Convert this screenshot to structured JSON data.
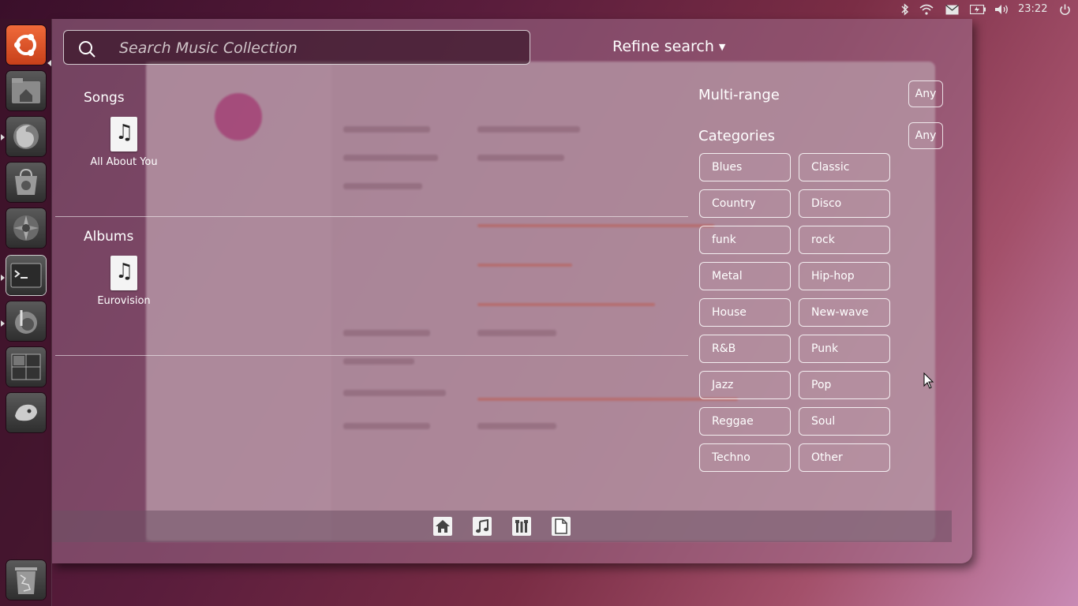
{
  "top_panel": {
    "clock": "23:22",
    "indicators": [
      "bluetooth-icon",
      "wifi-icon",
      "mail-icon",
      "battery-icon",
      "volume-icon",
      "power-icon"
    ]
  },
  "launcher": {
    "items": [
      "ubuntu-logo-icon",
      "home-folder-icon",
      "firefox-icon",
      "software-center-icon",
      "shotwell-icon",
      "terminal-icon",
      "banshee-icon",
      "workspaces-icon",
      "gwibber-icon",
      "trash-icon"
    ]
  },
  "search": {
    "placeholder": "Search Music Collection",
    "value": ""
  },
  "refine": {
    "label": "Refine search",
    "arrow": "▼"
  },
  "results": {
    "songs": {
      "title": "Songs",
      "items": [
        {
          "label": "All About You",
          "icon": "music-file-icon"
        }
      ]
    },
    "albums": {
      "title": "Albums",
      "items": [
        {
          "label": "Eurovision",
          "icon": "music-file-icon"
        }
      ]
    }
  },
  "filters": {
    "multirange": {
      "label": "Multi-range",
      "any": "Any"
    },
    "categories": {
      "label": "Categories",
      "any": "Any",
      "items": [
        "Blues",
        "Classic",
        "Country",
        "Disco",
        "funk",
        "rock",
        "Metal",
        "Hip-hop",
        "House",
        "New-wave",
        "R&B",
        "Punk",
        "Jazz",
        "Pop",
        "Reggae",
        "Soul",
        "Techno",
        "Other"
      ]
    }
  },
  "lens_bar": [
    "home-lens-icon",
    "music-lens-icon",
    "applications-lens-icon",
    "files-lens-icon"
  ]
}
